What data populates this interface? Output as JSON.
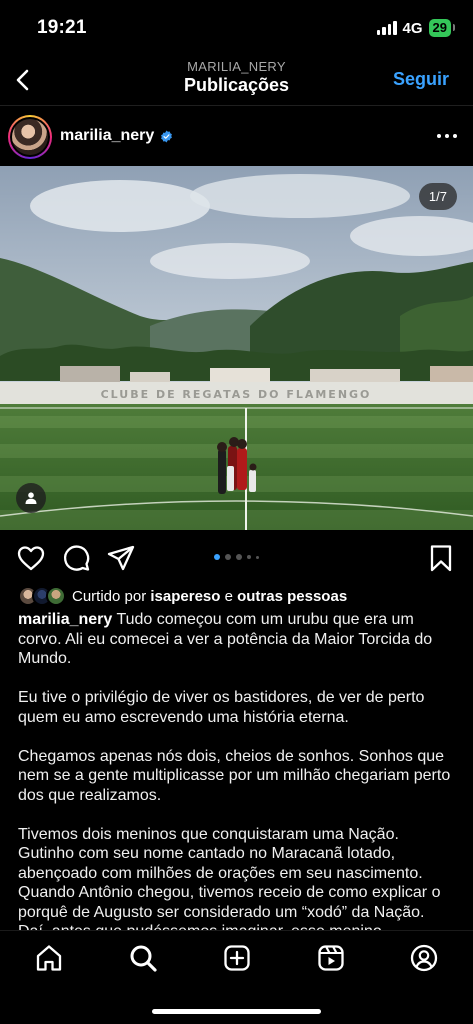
{
  "status": {
    "time": "19:21",
    "network": "4G",
    "battery": "29"
  },
  "header": {
    "username": "MARILIA_NERY",
    "title": "Publicações",
    "follow_label": "Seguir"
  },
  "post": {
    "author": "marilia_nery",
    "image_counter": "1/7",
    "image_wall_text": "CLUBE DE REGATAS DO FLAMENGO",
    "carousel_dots": 5,
    "active_dot": 0
  },
  "likes": {
    "prefix": "Curtido por",
    "user": "isapereso",
    "joiner": "e",
    "others": "outras pessoas"
  },
  "caption": {
    "author": "marilia_nery",
    "paragraphs": [
      "Tudo começou com um urubu que era um corvo. Ali eu comecei a ver a potência da Maior Torcida do Mundo.",
      "Eu tive o privilégio de viver os bastidores, de ver de perto quem eu amo escrevendo uma história eterna.",
      "Chegamos apenas nós dois, cheios de sonhos. Sonhos que nem se a gente multiplicasse por um milhão chegariam perto dos que realizamos.",
      "Tivemos dois meninos que conquistaram uma Nação. Gutinho com seu nome cantado no Maracanã lotado, abençoado com milhões de orações em seu nascimento. Quando Antônio chegou, tivemos receio de como explicar o porquê de Augusto ser considerado um “xodó” da Nação. Daí, antes que pudéssemos imaginar, esse menino"
    ]
  },
  "colors": {
    "accent": "#3aa2ff",
    "verified": "#3897f0",
    "battery": "#34c759"
  },
  "icons": [
    "back-icon",
    "verified-badge-icon",
    "more-options-icon",
    "tag-people-icon",
    "heart-icon",
    "comment-icon",
    "share-icon",
    "bookmark-icon",
    "home-icon",
    "search-icon",
    "create-icon",
    "reels-icon",
    "profile-icon"
  ]
}
